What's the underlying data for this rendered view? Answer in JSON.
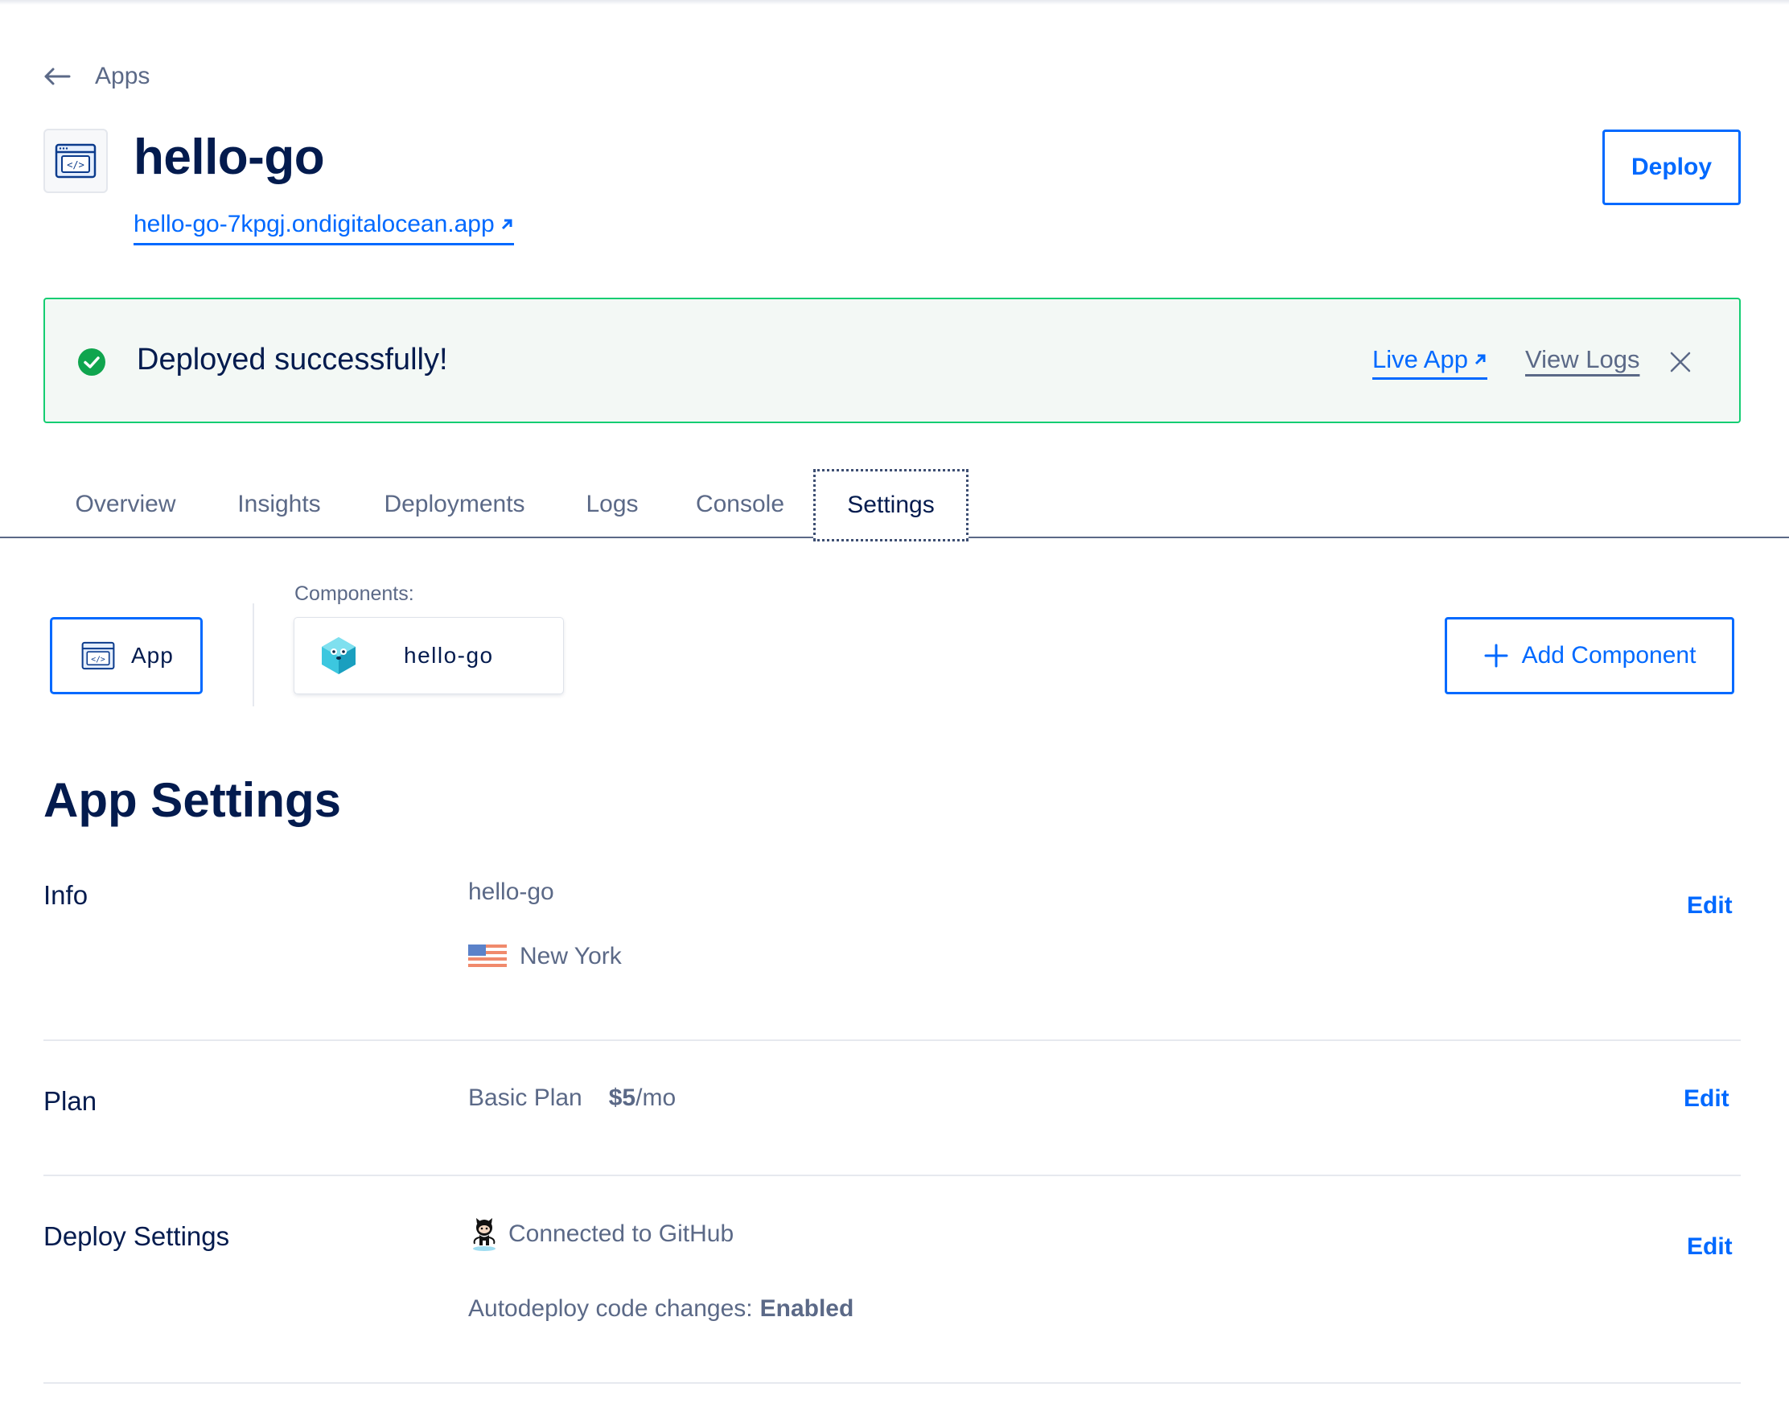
{
  "breadcrumb": {
    "back_label": "Apps"
  },
  "header": {
    "title": "hello-go",
    "url": "hello-go-7kpgj.ondigitalocean.app",
    "deploy_label": "Deploy"
  },
  "banner": {
    "message": "Deployed successfully!",
    "live_app_label": "Live App",
    "view_logs_label": "View Logs"
  },
  "tabs": [
    {
      "label": "Overview"
    },
    {
      "label": "Insights"
    },
    {
      "label": "Deployments"
    },
    {
      "label": "Logs"
    },
    {
      "label": "Console"
    },
    {
      "label": "Settings",
      "active": true
    }
  ],
  "components": {
    "label": "Components:",
    "app_label": "App",
    "items": [
      {
        "name": "hello-go"
      }
    ],
    "add_label": "Add Component"
  },
  "settings": {
    "title": "App Settings",
    "edit_label": "Edit",
    "info": {
      "label": "Info",
      "name": "hello-go",
      "region": "New York"
    },
    "plan": {
      "label": "Plan",
      "plan_name": "Basic Plan",
      "price": "$5",
      "period": "/mo"
    },
    "deploy": {
      "label": "Deploy Settings",
      "source": "Connected to GitHub",
      "autodeploy_label": "Autodeploy code changes:",
      "autodeploy_value": "Enabled"
    }
  },
  "colors": {
    "primary": "#0069ff",
    "text_dark": "#031b4e",
    "text_muted": "#5b6987",
    "success": "#15cd72",
    "success_bg": "#f3f8f5"
  },
  "icons": [
    "arrow-left-icon",
    "code-window-icon",
    "external-link-icon",
    "check-circle-icon",
    "close-icon",
    "go-gopher-icon",
    "plus-icon",
    "us-flag-icon",
    "github-octocat-icon"
  ]
}
